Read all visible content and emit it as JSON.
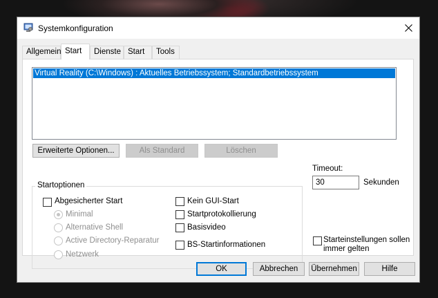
{
  "window": {
    "title": "Systemkonfiguration"
  },
  "tabs": [
    {
      "label": "Allgemein",
      "active": false
    },
    {
      "label": "Start",
      "active": true
    },
    {
      "label": "Dienste",
      "active": false
    },
    {
      "label": "Start",
      "active": false
    },
    {
      "label": "Tools",
      "active": false
    }
  ],
  "boot_list": {
    "entries": [
      "Virtual Reality (C:\\Windows) : Aktuelles Betriebssystem; Standardbetriebssystem"
    ]
  },
  "buttons": {
    "advanced": "Erweiterte Optionen...",
    "set_default": "Als Standard",
    "delete": "Löschen",
    "ok": "OK",
    "cancel": "Abbrechen",
    "apply": "Übernehmen",
    "help": "Hilfe"
  },
  "boot_options": {
    "legend": "Startoptionen",
    "safe_boot": "Abgesicherter Start",
    "minimal": "Minimal",
    "alternate_shell": "Alternative Shell",
    "ad_repair": "Active Directory-Reparatur",
    "network": "Netzwerk",
    "no_gui": "Kein GUI-Start",
    "boot_log": "Startprotokollierung",
    "base_video": "Basisvideo",
    "os_boot_info": "BS-Startinformationen"
  },
  "timeout": {
    "label": "Timeout:",
    "value": "30",
    "unit": "Sekunden"
  },
  "persist": {
    "line1": "Starteinstellungen sollen",
    "line2": "immer gelten"
  },
  "colors": {
    "selection": "#0078d7",
    "window_bg": "#f0f0f0"
  }
}
